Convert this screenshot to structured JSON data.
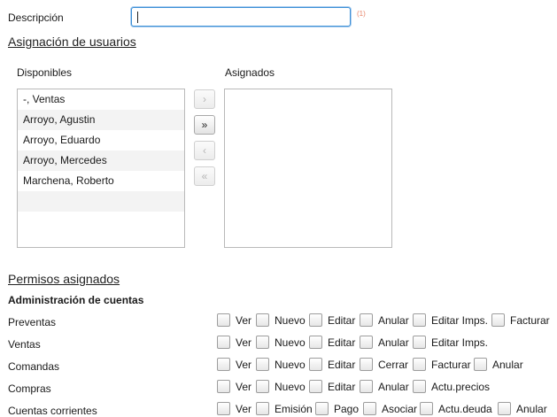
{
  "form": {
    "description_label": "Descripción",
    "description_value": "",
    "required_marker": "(1)"
  },
  "users_section": {
    "title": "Asignación de usuarios",
    "available_label": "Disponibles",
    "assigned_label": "Asignados",
    "available": [
      "-, Ventas",
      "Arroyo, Agustin",
      "Arroyo, Eduardo",
      "Arroyo, Mercedes",
      "Marchena, Roberto"
    ],
    "assigned": [],
    "buttons": [
      {
        "label": "›",
        "name": "move-right-button",
        "enabled": false
      },
      {
        "label": "»",
        "name": "move-all-right-button",
        "enabled": true
      },
      {
        "label": "‹",
        "name": "move-left-button",
        "enabled": false
      },
      {
        "label": "«",
        "name": "move-all-left-button",
        "enabled": false
      }
    ]
  },
  "permissions": {
    "title": "Permisos asignados",
    "group_title": "Administración de cuentas",
    "rows": [
      {
        "label": "Preventas",
        "options": [
          "Ver",
          "Nuevo",
          "Editar",
          "Anular",
          "Editar Imps.",
          "Facturar"
        ]
      },
      {
        "label": "Ventas",
        "options": [
          "Ver",
          "Nuevo",
          "Editar",
          "Anular",
          "Editar Imps."
        ]
      },
      {
        "label": "Comandas",
        "options": [
          "Ver",
          "Nuevo",
          "Editar",
          "Cerrar",
          "Facturar",
          "Anular"
        ]
      },
      {
        "label": "Compras",
        "options": [
          "Ver",
          "Nuevo",
          "Editar",
          "Anular",
          "Actu.precios"
        ]
      },
      {
        "label": "Cuentas corrientes",
        "options": [
          "Ver",
          "Emisión",
          "Pago",
          "Asociar",
          "Actu.deuda",
          "Anular"
        ]
      }
    ]
  }
}
